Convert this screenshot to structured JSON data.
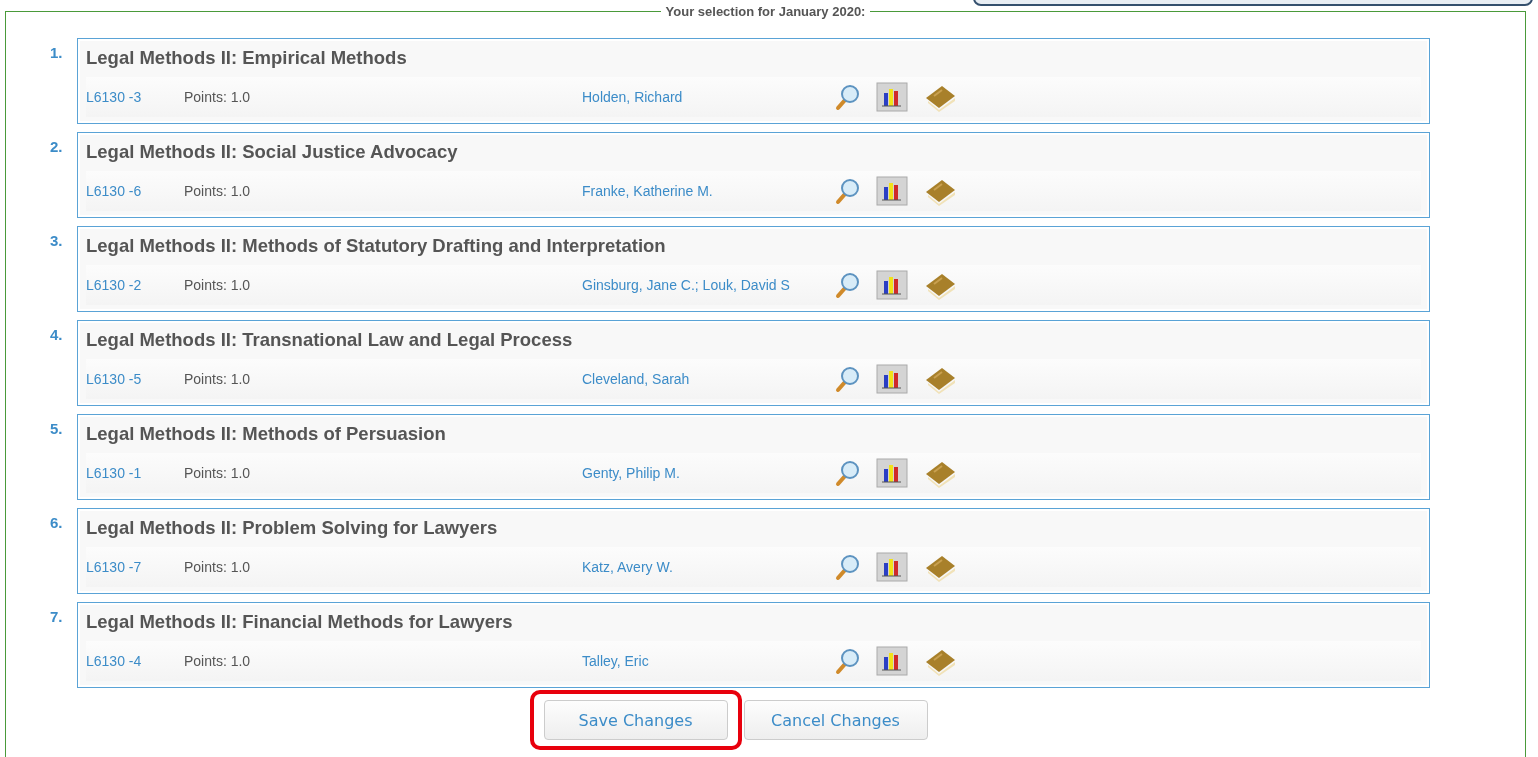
{
  "legend": "Your selection for January 2020:",
  "courses": [
    {
      "number": "1.",
      "title": "Legal Methods II: Empirical Methods",
      "code": "L6130 -3",
      "points": "Points: 1.0",
      "instructor": "Holden, Richard"
    },
    {
      "number": "2.",
      "title": "Legal Methods II: Social Justice Advocacy",
      "code": "L6130 -6",
      "points": "Points: 1.0",
      "instructor": "Franke, Katherine M."
    },
    {
      "number": "3.",
      "title": "Legal Methods II: Methods of Statutory Drafting and Interpretation",
      "code": "L6130 -2",
      "points": "Points: 1.0",
      "instructor": "Ginsburg, Jane C.;  Louk, David S"
    },
    {
      "number": "4.",
      "title": "Legal Methods II: Transnational Law and Legal Process",
      "code": "L6130 -5",
      "points": "Points: 1.0",
      "instructor": "Cleveland, Sarah"
    },
    {
      "number": "5.",
      "title": "Legal Methods II: Methods of Persuasion",
      "code": "L6130 -1",
      "points": "Points: 1.0",
      "instructor": "Genty, Philip M."
    },
    {
      "number": "6.",
      "title": "Legal Methods II: Problem Solving for Lawyers",
      "code": "L6130 -7",
      "points": "Points: 1.0",
      "instructor": "Katz, Avery W."
    },
    {
      "number": "7.",
      "title": "Legal Methods II: Financial Methods for Lawyers",
      "code": "L6130 -4",
      "points": "Points: 1.0",
      "instructor": "Talley, Eric"
    }
  ],
  "buttons": [
    {
      "label": "Save Changes",
      "highlighted": true
    },
    {
      "label": "Cancel Changes",
      "highlighted": false
    }
  ]
}
